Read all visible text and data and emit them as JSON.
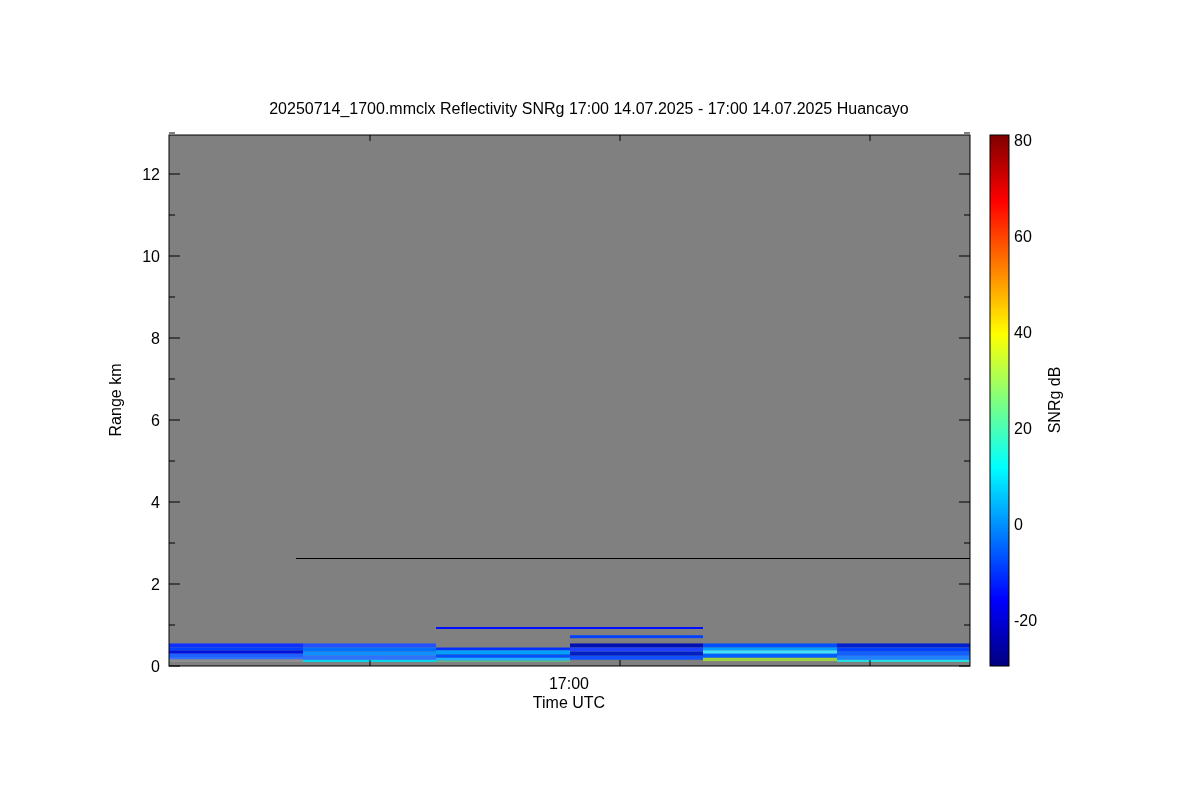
{
  "title": "20250714_1700.mmclx Reflectivity SNRg   17:00 14.07.2025 - 17:00 14.07.2025 Huancayo",
  "y_axis": {
    "label": "Range km",
    "ticks": [
      "12",
      "10",
      "8",
      "6",
      "4",
      "2",
      "0"
    ]
  },
  "x_axis": {
    "label": "Time UTC",
    "ticks": [
      "17:00"
    ]
  },
  "colorbar": {
    "label": "SNRg dB",
    "ticks": [
      "80",
      "60",
      "40",
      "20",
      "0",
      "-20"
    ]
  }
}
